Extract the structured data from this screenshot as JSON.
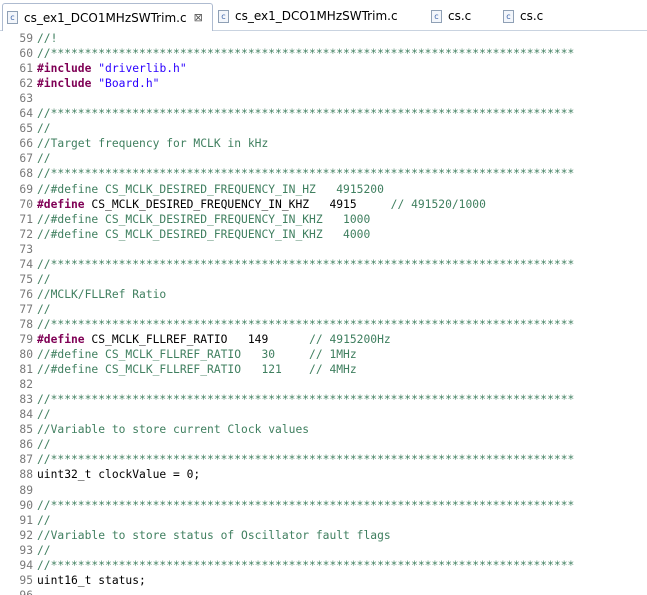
{
  "tabs": [
    {
      "label": "cs_ex1_DCO1MHzSWTrim.c",
      "icon": "c-file-icon",
      "close": "⊠"
    },
    {
      "label": "cs_ex1_DCO1MHzSWTrim.c",
      "icon": "c-file-icon"
    },
    {
      "label": "cs.c",
      "icon": "c-file-icon"
    },
    {
      "label": "cs.c",
      "icon": "c-file-icon"
    }
  ],
  "file_icon_glyph": "c",
  "colors": {
    "comment": "#3f7f5f",
    "keyword": "#7f0055",
    "string": "#2a00ff",
    "line_number": "#787878"
  },
  "lines": [
    {
      "n": "59",
      "s": [
        {
          "t": "//!",
          "c": "cm"
        }
      ]
    },
    {
      "n": "60",
      "s": [
        {
          "t": "//*****************************************************************************",
          "c": "cm"
        }
      ]
    },
    {
      "n": "61",
      "s": [
        {
          "t": "#include",
          "c": "pp"
        },
        {
          "t": " ",
          "c": "tx"
        },
        {
          "t": "\"driverlib.h\"",
          "c": "st"
        }
      ]
    },
    {
      "n": "62",
      "s": [
        {
          "t": "#include",
          "c": "pp"
        },
        {
          "t": " ",
          "c": "tx"
        },
        {
          "t": "\"Board.h\"",
          "c": "st"
        }
      ]
    },
    {
      "n": "63",
      "s": []
    },
    {
      "n": "64",
      "s": [
        {
          "t": "//*****************************************************************************",
          "c": "cm"
        }
      ]
    },
    {
      "n": "65",
      "s": [
        {
          "t": "//",
          "c": "cm"
        }
      ]
    },
    {
      "n": "66",
      "s": [
        {
          "t": "//Target frequency for MCLK in kHz",
          "c": "cm"
        }
      ]
    },
    {
      "n": "67",
      "s": [
        {
          "t": "//",
          "c": "cm"
        }
      ]
    },
    {
      "n": "68",
      "s": [
        {
          "t": "//*****************************************************************************",
          "c": "cm"
        }
      ]
    },
    {
      "n": "69",
      "s": [
        {
          "t": "//#define CS_MCLK_DESIRED_FREQUENCY_IN_HZ   4915200",
          "c": "cm"
        }
      ]
    },
    {
      "n": "70",
      "s": [
        {
          "t": "#define",
          "c": "pp"
        },
        {
          "t": " CS_MCLK_DESIRED_FREQUENCY_IN_KHZ   4915     ",
          "c": "tx"
        },
        {
          "t": "// 491520/1000",
          "c": "cm"
        }
      ]
    },
    {
      "n": "71",
      "s": [
        {
          "t": "//#define CS_MCLK_DESIRED_FREQUENCY_IN_KHZ   1000",
          "c": "cm"
        }
      ]
    },
    {
      "n": "72",
      "s": [
        {
          "t": "//#define CS_MCLK_DESIRED_FREQUENCY_IN_KHZ   4000",
          "c": "cm"
        }
      ]
    },
    {
      "n": "73",
      "s": []
    },
    {
      "n": "74",
      "s": [
        {
          "t": "//*****************************************************************************",
          "c": "cm"
        }
      ]
    },
    {
      "n": "75",
      "s": [
        {
          "t": "//",
          "c": "cm"
        }
      ]
    },
    {
      "n": "76",
      "s": [
        {
          "t": "//MCLK/FLLRef Ratio",
          "c": "cm"
        }
      ]
    },
    {
      "n": "77",
      "s": [
        {
          "t": "//",
          "c": "cm"
        }
      ]
    },
    {
      "n": "78",
      "s": [
        {
          "t": "//*****************************************************************************",
          "c": "cm"
        }
      ]
    },
    {
      "n": "79",
      "s": [
        {
          "t": "#define",
          "c": "pp"
        },
        {
          "t": " CS_MCLK_FLLREF_RATIO   149      ",
          "c": "tx"
        },
        {
          "t": "// 4915200Hz",
          "c": "cm"
        }
      ]
    },
    {
      "n": "80",
      "s": [
        {
          "t": "//#define CS_MCLK_FLLREF_RATIO   30     // 1MHz",
          "c": "cm"
        }
      ]
    },
    {
      "n": "81",
      "s": [
        {
          "t": "//#define CS_MCLK_FLLREF_RATIO   121    // 4MHz",
          "c": "cm"
        }
      ]
    },
    {
      "n": "82",
      "s": []
    },
    {
      "n": "83",
      "s": [
        {
          "t": "//*****************************************************************************",
          "c": "cm"
        }
      ]
    },
    {
      "n": "84",
      "s": [
        {
          "t": "//",
          "c": "cm"
        }
      ]
    },
    {
      "n": "85",
      "s": [
        {
          "t": "//Variable to store current Clock values",
          "c": "cm"
        }
      ]
    },
    {
      "n": "86",
      "s": [
        {
          "t": "//",
          "c": "cm"
        }
      ]
    },
    {
      "n": "87",
      "s": [
        {
          "t": "//*****************************************************************************",
          "c": "cm"
        }
      ]
    },
    {
      "n": "88",
      "s": [
        {
          "t": "uint32_t clockValue = 0;",
          "c": "tx"
        }
      ]
    },
    {
      "n": "89",
      "s": []
    },
    {
      "n": "90",
      "s": [
        {
          "t": "//*****************************************************************************",
          "c": "cm"
        }
      ]
    },
    {
      "n": "91",
      "s": [
        {
          "t": "//",
          "c": "cm"
        }
      ]
    },
    {
      "n": "92",
      "s": [
        {
          "t": "//Variable to store status of Oscillator fault flags",
          "c": "cm"
        }
      ]
    },
    {
      "n": "93",
      "s": [
        {
          "t": "//",
          "c": "cm"
        }
      ]
    },
    {
      "n": "94",
      "s": [
        {
          "t": "//*****************************************************************************",
          "c": "cm"
        }
      ]
    },
    {
      "n": "95",
      "s": [
        {
          "t": "uint16_t status;",
          "c": "tx"
        }
      ]
    },
    {
      "n": "96",
      "s": []
    }
  ]
}
